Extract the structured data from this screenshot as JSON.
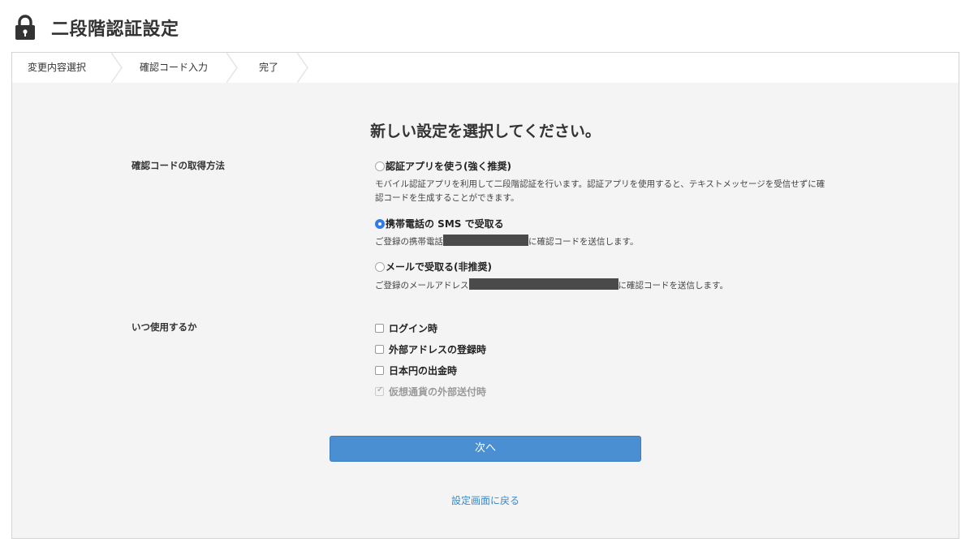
{
  "header": {
    "title": "二段階認証設定",
    "icon": "lock-icon"
  },
  "steps": [
    {
      "label": "変更内容選択"
    },
    {
      "label": "確認コード入力"
    },
    {
      "label": "完了"
    }
  ],
  "heading": "新しい設定を選択してください。",
  "method": {
    "label": "確認コードの取得方法",
    "options": [
      {
        "label": "認証アプリを使う(強く推奨)",
        "checked": false,
        "desc_line1": "モバイル認証アプリを利用して二段階認証を行います。認証アプリを使用すると、テキストメッセージを受信せずに確",
        "desc_line2": "認コードを生成することができます。"
      },
      {
        "label": "携帯電話の SMS で受取る",
        "checked": true,
        "desc_prefix": "ご登録の携帯電話",
        "desc_suffix": "に確認コードを送信します。"
      },
      {
        "label": "メールで受取る(非推奨)",
        "checked": false,
        "desc_prefix": "ご登録のメールアドレス",
        "desc_suffix": "に確認コードを送信します。"
      }
    ]
  },
  "usage": {
    "label": "いつ使用するか",
    "options": [
      {
        "label": "ログイン時",
        "checked": false,
        "disabled": false
      },
      {
        "label": "外部アドレスの登録時",
        "checked": false,
        "disabled": false
      },
      {
        "label": "日本円の出金時",
        "checked": false,
        "disabled": false
      },
      {
        "label": "仮想通貨の外部送付時",
        "checked": true,
        "disabled": true
      }
    ]
  },
  "next_button": "次へ",
  "back_link": "設定画面に戻る",
  "colors": {
    "primary": "#4a8fd1",
    "link": "#3d89c9",
    "radio_checked": "#2f7be8",
    "redaction": "#4a4a4a"
  }
}
